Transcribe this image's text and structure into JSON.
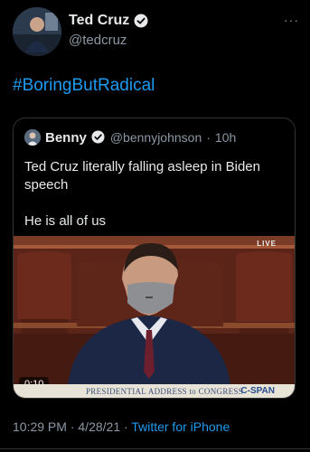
{
  "author": {
    "display_name": "Ted Cruz",
    "handle": "@tedcruz",
    "verified_icon": "verified-badge-icon",
    "avatar": "avatar-photo"
  },
  "menu": {
    "more_label": "···"
  },
  "tweet": {
    "hashtag": "#BoringButRadical"
  },
  "quoted": {
    "display_name": "Benny",
    "handle": "@bennyjohnson",
    "separator": "·",
    "time": "10h",
    "text_line1": "Ted Cruz literally falling asleep in Biden speech",
    "text_line2": "He is all of us",
    "video": {
      "live_label": "LIVE",
      "duration": "0:10",
      "chyron": "PRESIDENTIAL ADDRESS to CONGRESS",
      "network": "C-SPAN"
    }
  },
  "meta": {
    "time": "10:29 PM",
    "separator1": " · ",
    "date": "4/28/21",
    "separator2": " · ",
    "source": "Twitter for iPhone"
  },
  "colors": {
    "background": "#000000",
    "link": "#1d9bf0",
    "secondary_text": "#8b98a5",
    "primary_text": "#e7e9ea",
    "border": "#2f3336"
  }
}
